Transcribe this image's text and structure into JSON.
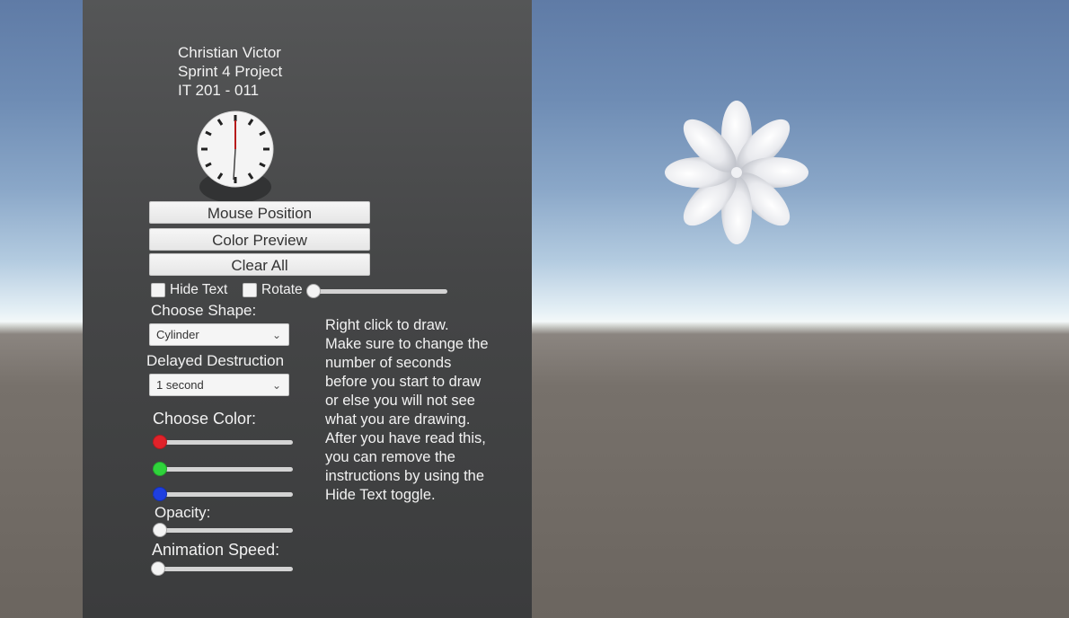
{
  "header": {
    "author": "Christian Victor",
    "project": "Sprint 4 Project",
    "course": "IT 201 - 011"
  },
  "buttons": {
    "mouse_position": "Mouse Position",
    "color_preview": "Color Preview",
    "clear_all": "Clear All"
  },
  "toggles": {
    "hide_text": {
      "label": "Hide Text",
      "checked": false
    },
    "rotate": {
      "label": "Rotate",
      "checked": false
    }
  },
  "rotate_slider": {
    "value": 0
  },
  "shape": {
    "label": "Choose Shape:",
    "selected": "Cylinder"
  },
  "destruction": {
    "label": "Delayed Destruction",
    "selected": "1 second"
  },
  "color": {
    "label": "Choose Color:",
    "red": {
      "value": 0,
      "knob_color": "#e0222a"
    },
    "green": {
      "value": 0,
      "knob_color": "#2fd33b"
    },
    "blue": {
      "value": 0,
      "knob_color": "#1f3fe0"
    }
  },
  "opacity": {
    "label": "Opacity:",
    "value": 0
  },
  "animation_speed": {
    "label": "Animation Speed:",
    "value": 0
  },
  "instructions": [
    "Right click to draw.",
    "Make sure to change the",
    "number of seconds",
    "before you start to draw",
    "or else you will not see",
    "what you are drawing.",
    "After you have read this,",
    "you can remove the",
    "instructions by using the",
    "Hide Text toggle."
  ],
  "colors": {
    "panel": "#464748",
    "button_bg": "#eeeeee",
    "text": "#f2f2f2"
  },
  "icons": {
    "clock": "clock-icon",
    "flower": "flower-shape",
    "chevron": "chevron-down-icon"
  }
}
